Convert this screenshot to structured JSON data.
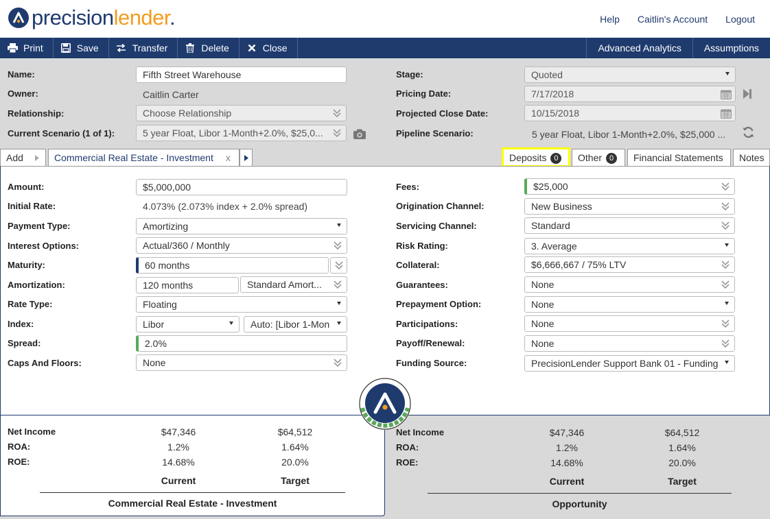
{
  "brand": {
    "name_part1": "precision",
    "name_part2": "lender",
    "dot": "."
  },
  "top_links": [
    "Help",
    "Caitlin's Account",
    "Logout"
  ],
  "toolbar": {
    "print": "Print",
    "save": "Save",
    "transfer": "Transfer",
    "delete": "Delete",
    "close": "Close",
    "advanced_analytics": "Advanced Analytics",
    "assumptions": "Assumptions"
  },
  "header_form": {
    "name_label": "Name:",
    "name_value": "Fifth Street Warehouse",
    "owner_label": "Owner:",
    "owner_value": "Caitlin Carter",
    "relationship_label": "Relationship:",
    "relationship_value": "Choose Relationship",
    "scenario_label": "Current Scenario (1 of 1):",
    "scenario_value": "5 year Float, Libor 1-Month+2.0%, $25,0...",
    "stage_label": "Stage:",
    "stage_value": "Quoted",
    "pricing_date_label": "Pricing Date:",
    "pricing_date_value": "7/17/2018",
    "close_date_label": "Projected Close Date:",
    "close_date_value": "10/15/2018",
    "pipeline_label": "Pipeline Scenario:",
    "pipeline_value": "5 year Float, Libor 1-Month+2.0%, $25,000 ..."
  },
  "tabs": {
    "add": "Add",
    "active": "Commercial Real Estate - Investment",
    "active_close": "x",
    "deposits": "Deposits",
    "deposits_count": "0",
    "other": "Other",
    "other_count": "0",
    "financial_statements": "Financial Statements",
    "notes": "Notes"
  },
  "loan_left": {
    "amount_label": "Amount:",
    "amount_value": "$5,000,000",
    "initial_rate_label": "Initial Rate:",
    "initial_rate_value": "4.073% (2.073% index + 2.0% spread)",
    "payment_type_label": "Payment Type:",
    "payment_type_value": "Amortizing",
    "interest_options_label": "Interest Options:",
    "interest_options_value": "Actual/360 / Monthly",
    "maturity_label": "Maturity:",
    "maturity_value": "60 months",
    "amortization_label": "Amortization:",
    "amortization_value": "120 months",
    "amortization_type": "Standard Amort...",
    "rate_type_label": "Rate Type:",
    "rate_type_value": "Floating",
    "index_label": "Index:",
    "index_value": "Libor",
    "index_auto": "Auto: [Libor 1-Mon",
    "spread_label": "Spread:",
    "spread_value": "2.0%",
    "caps_label": "Caps And Floors:",
    "caps_value": "None"
  },
  "loan_right": {
    "fees_label": "Fees:",
    "fees_value": "$25,000",
    "origination_label": "Origination Channel:",
    "origination_value": "New Business",
    "servicing_label": "Servicing Channel:",
    "servicing_value": "Standard",
    "risk_label": "Risk Rating:",
    "risk_value": "3. Average",
    "collateral_label": "Collateral:",
    "collateral_value": "$6,666,667 / 75% LTV",
    "guarantees_label": "Guarantees:",
    "guarantees_value": "None",
    "prepayment_label": "Prepayment Option:",
    "prepayment_value": "None",
    "participations_label": "Participations:",
    "participations_value": "None",
    "payoff_label": "Payoff/Renewal:",
    "payoff_value": "None",
    "funding_label": "Funding Source:",
    "funding_value": "PrecisionLender Support Bank 01 - Funding"
  },
  "summary_loan": {
    "net_income_label": "Net Income",
    "roa_label": "ROA:",
    "roe_label": "ROE:",
    "current_net_income": "$47,346",
    "target_net_income": "$64,512",
    "current_roa": "1.2%",
    "target_roa": "1.64%",
    "current_roe": "14.68%",
    "target_roe": "20.0%",
    "current_label": "Current",
    "target_label": "Target",
    "title": "Commercial Real Estate - Investment"
  },
  "summary_opportunity": {
    "net_income_label": "Net Income",
    "roa_label": "ROA:",
    "roe_label": "ROE:",
    "current_net_income": "$47,346",
    "target_net_income": "$64,512",
    "current_roa": "1.2%",
    "target_roa": "1.64%",
    "current_roe": "14.68%",
    "target_roe": "20.0%",
    "current_label": "Current",
    "target_label": "Target",
    "title": "Opportunity"
  },
  "colors": {
    "navy": "#1f3b6e",
    "orange": "#f39c1e",
    "green": "#5aa85a",
    "highlight": "#ffff00"
  }
}
